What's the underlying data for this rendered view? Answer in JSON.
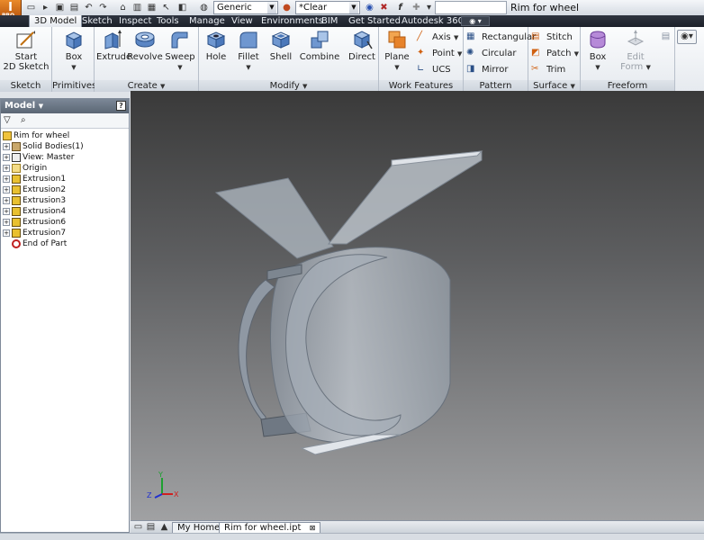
{
  "app": {
    "logo_letter": "I",
    "edition": "PRO"
  },
  "qat": {
    "material": "Generic",
    "appearance": "*Clear",
    "fx": "f",
    "doc_title": "Rim for wheel"
  },
  "tabs": [
    {
      "label": "3D Model"
    },
    {
      "label": "Sketch"
    },
    {
      "label": "Inspect"
    },
    {
      "label": "Tools"
    },
    {
      "label": "Manage"
    },
    {
      "label": "View"
    },
    {
      "label": "Environments"
    },
    {
      "label": "BIM"
    },
    {
      "label": "Get Started"
    },
    {
      "label": "Autodesk 360"
    }
  ],
  "ribbon": {
    "sketch": {
      "title": "Sketch",
      "start_line1": "Start",
      "start_line2": "2D Sketch"
    },
    "primitives": {
      "title": "Primitives",
      "box": "Box"
    },
    "create": {
      "title": "Create",
      "extrude": "Extrude",
      "revolve": "Revolve",
      "sweep": "Sweep"
    },
    "modify": {
      "title": "Modify",
      "hole": "Hole",
      "fillet": "Fillet",
      "shell": "Shell",
      "combine": "Combine",
      "direct": "Direct"
    },
    "work": {
      "title": "Work Features",
      "plane": "Plane",
      "axis": "Axis",
      "point": "Point",
      "ucs": "UCS"
    },
    "pattern": {
      "title": "Pattern",
      "rectangular": "Rectangular",
      "circular": "Circular",
      "mirror": "Mirror"
    },
    "surface": {
      "title": "Surface",
      "stitch": "Stitch",
      "patch": "Patch",
      "trim": "Trim"
    },
    "freeform": {
      "title": "Freeform",
      "box": "Box",
      "edit_line1": "Edit",
      "edit_line2": "Form"
    }
  },
  "browser": {
    "title": "Model",
    "help": "?",
    "tree": [
      {
        "label": "Rim for wheel",
        "icon": "part-icon"
      },
      {
        "label": "Solid Bodies(1)",
        "icon": "solid-bodies-icon"
      },
      {
        "label": "View: Master",
        "icon": "view-icon"
      },
      {
        "label": "Origin",
        "icon": "folder-icon"
      },
      {
        "label": "Extrusion1",
        "icon": "extrusion-icon"
      },
      {
        "label": "Extrusion2",
        "icon": "extrusion-icon"
      },
      {
        "label": "Extrusion3",
        "icon": "extrusion-icon"
      },
      {
        "label": "Extrusion4",
        "icon": "extrusion-icon"
      },
      {
        "label": "Extrusion6",
        "icon": "extrusion-icon"
      },
      {
        "label": "Extrusion7",
        "icon": "extrusion-icon"
      },
      {
        "label": "End of Part",
        "icon": "end-of-part-icon"
      }
    ]
  },
  "doc_tabs": [
    {
      "label": "My Home"
    },
    {
      "label": "Rim for wheel.ipt"
    }
  ],
  "triad": {
    "x": "X",
    "y": "Y",
    "z": "Z"
  },
  "colors": {
    "accent": "#e98a2a",
    "tab_bar": "#1c2029",
    "viewport_top": "#3a3a3a",
    "viewport_bottom": "#a0a1a3"
  }
}
